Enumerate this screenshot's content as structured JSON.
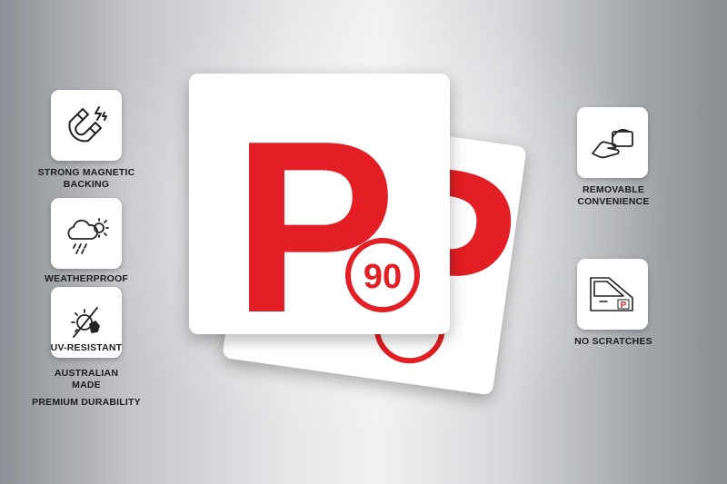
{
  "features_left": [
    {
      "label_line1": "STRONG MAGNETIC",
      "label_line2": "BACKING",
      "icon": "magnet-icon"
    },
    {
      "label_line1": "WEATHERPROOF",
      "label_line2": "",
      "icon": "weather-icon"
    },
    {
      "label_line1": "UV-RESISTANT",
      "label_line2": "",
      "icon": "uv-sun-icon"
    }
  ],
  "features_left_extra": [
    {
      "label_line1": "AUSTRALIAN",
      "label_line2": "MADE"
    },
    {
      "label_line1": "PREMIUM DURABILITY",
      "label_line2": ""
    }
  ],
  "features_right": [
    {
      "label_line1": "REMOVABLE",
      "label_line2": "CONVENIENCE",
      "icon": "hand-peel-icon"
    },
    {
      "label_line1": "NO SCRATCHES",
      "label_line2": "",
      "icon": "car-door-icon"
    }
  ],
  "plate": {
    "letter": "P",
    "speed_limit": "90",
    "color": "#e31e24"
  }
}
